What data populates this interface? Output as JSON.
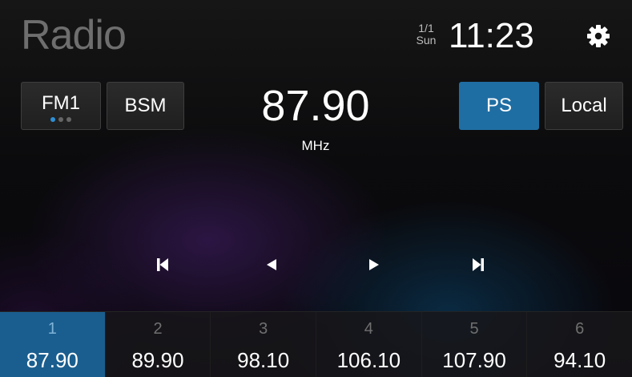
{
  "header": {
    "title": "Radio",
    "date": "1/1",
    "day": "Sun",
    "time": "11:23",
    "settings_icon": "gear-icon"
  },
  "controls": {
    "band_label": "FM1",
    "band_page_dots": {
      "count": 3,
      "active_index": 0
    },
    "bsm_label": "BSM",
    "ps_label": "PS",
    "local_label": "Local"
  },
  "tuner": {
    "frequency": "87.90",
    "unit": "MHz"
  },
  "playback": {
    "icons": [
      "skip-previous-icon",
      "seek-back-icon",
      "seek-forward-icon",
      "skip-next-icon"
    ]
  },
  "presets": [
    {
      "number": "1",
      "frequency": "87.90",
      "active": true
    },
    {
      "number": "2",
      "frequency": "89.90",
      "active": false
    },
    {
      "number": "3",
      "frequency": "98.10",
      "active": false
    },
    {
      "number": "4",
      "frequency": "106.10",
      "active": false
    },
    {
      "number": "5",
      "frequency": "107.90",
      "active": false
    },
    {
      "number": "6",
      "frequency": "94.10",
      "active": false
    }
  ],
  "colors": {
    "accent": "#1f6ea3",
    "preset_active": "#1a5e8f",
    "title_gray": "#6e6e6e"
  }
}
